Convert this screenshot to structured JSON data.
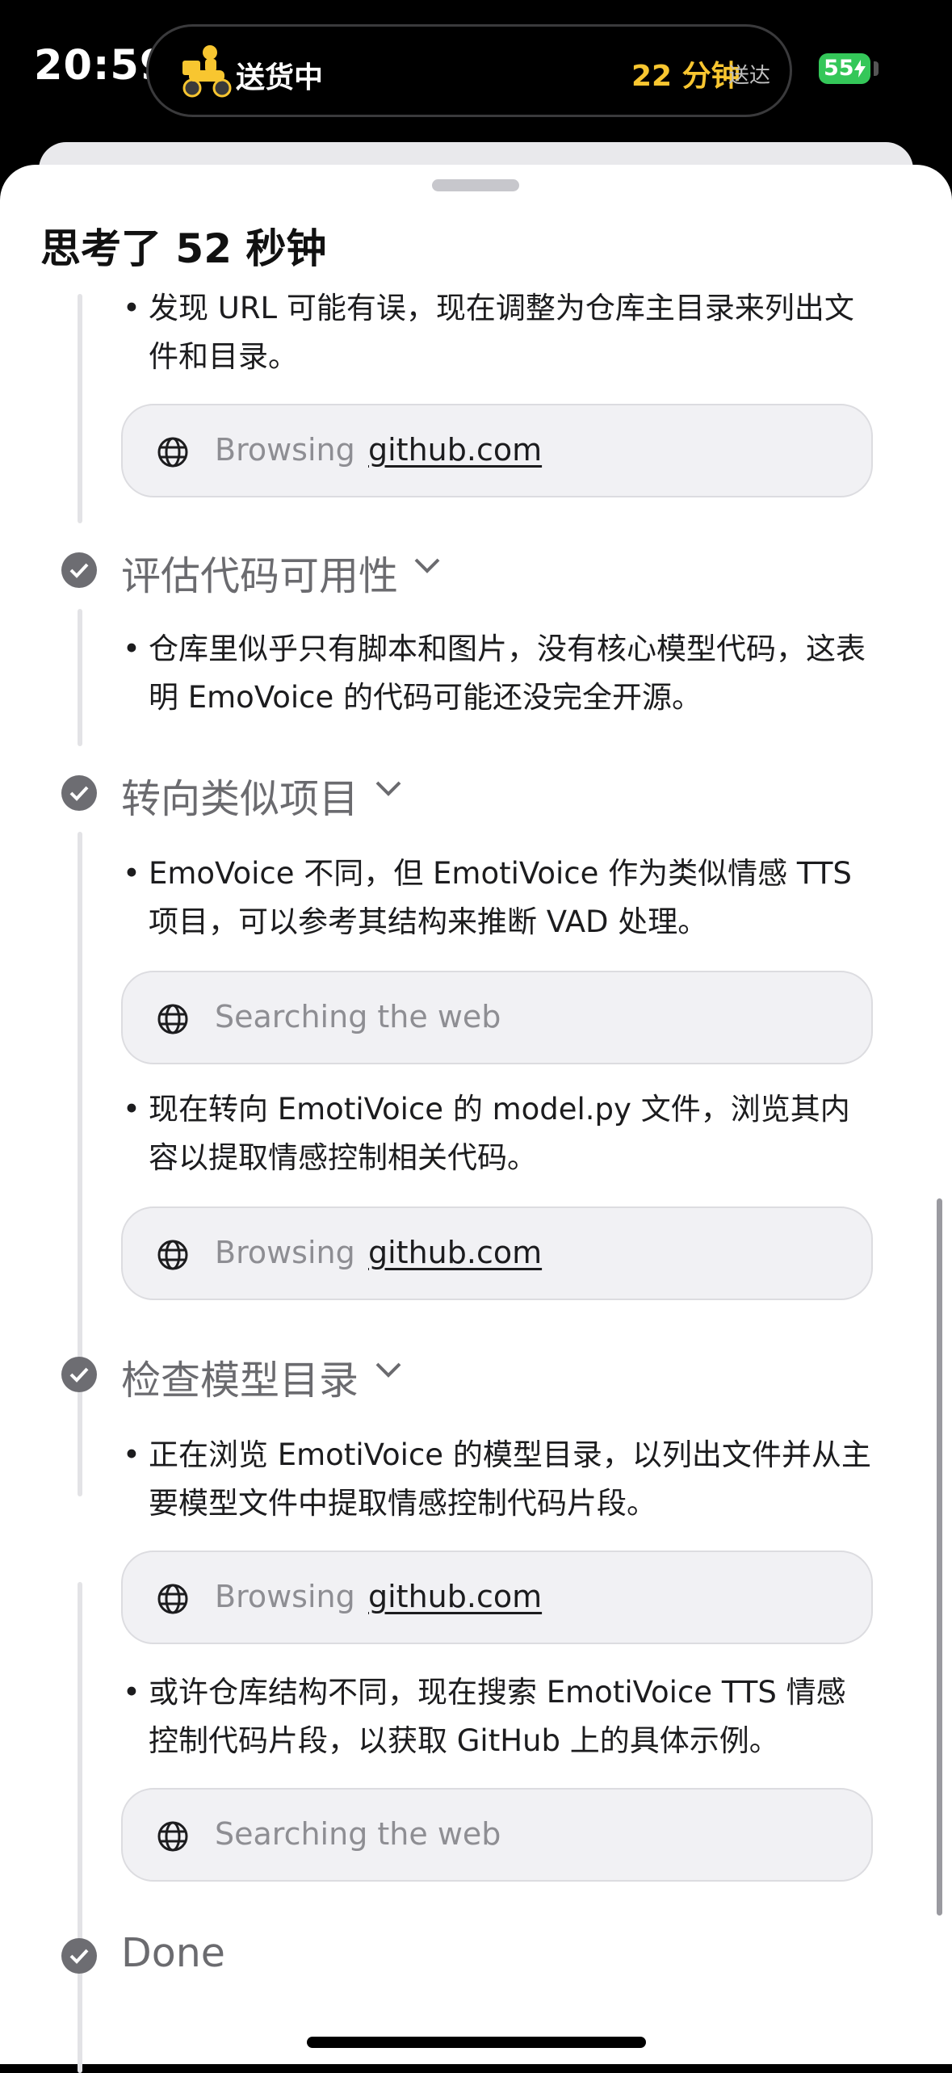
{
  "status_bar": {
    "time": "20:59",
    "live_activity": {
      "label": "送货中",
      "eta_value": "22 分钟",
      "eta_suffix": "送达"
    },
    "battery": "55"
  },
  "sheet": {
    "title": "思考了 52 秒钟"
  },
  "content": {
    "bullet_1": "发现 URL 可能有误，现在调整为仓库主目录来列出文件和目录。",
    "chip_1": {
      "label": "Browsing",
      "link": "github.com"
    },
    "step_1": "评估代码可用性",
    "bullet_2": "仓库里似乎只有脚本和图片，没有核心模型代码，这表明 EmoVoice 的代码可能还没完全开源。",
    "step_2": "转向类似项目",
    "bullet_3": "EmoVoice 不同，但 EmotiVoice 作为类似情感 TTS 项目，可以参考其结构来推断 VAD 处理。",
    "chip_2": {
      "label": "Searching the web"
    },
    "bullet_4": "现在转向 EmotiVoice 的 model.py 文件，浏览其内容以提取情感控制相关代码。",
    "chip_3": {
      "label": "Browsing",
      "link": "github.com"
    },
    "step_3": "检查模型目录",
    "bullet_5": "正在浏览 EmotiVoice 的模型目录，以列出文件并从主要模型文件中提取情感控制代码片段。",
    "chip_4": {
      "label": "Browsing",
      "link": "github.com"
    },
    "bullet_6": "或许仓库结构不同，现在搜索 EmotiVoice TTS 情感控制代码片段，以获取 GitHub 上的具体示例。",
    "chip_5": {
      "label": "Searching the web"
    },
    "done": "Done"
  }
}
